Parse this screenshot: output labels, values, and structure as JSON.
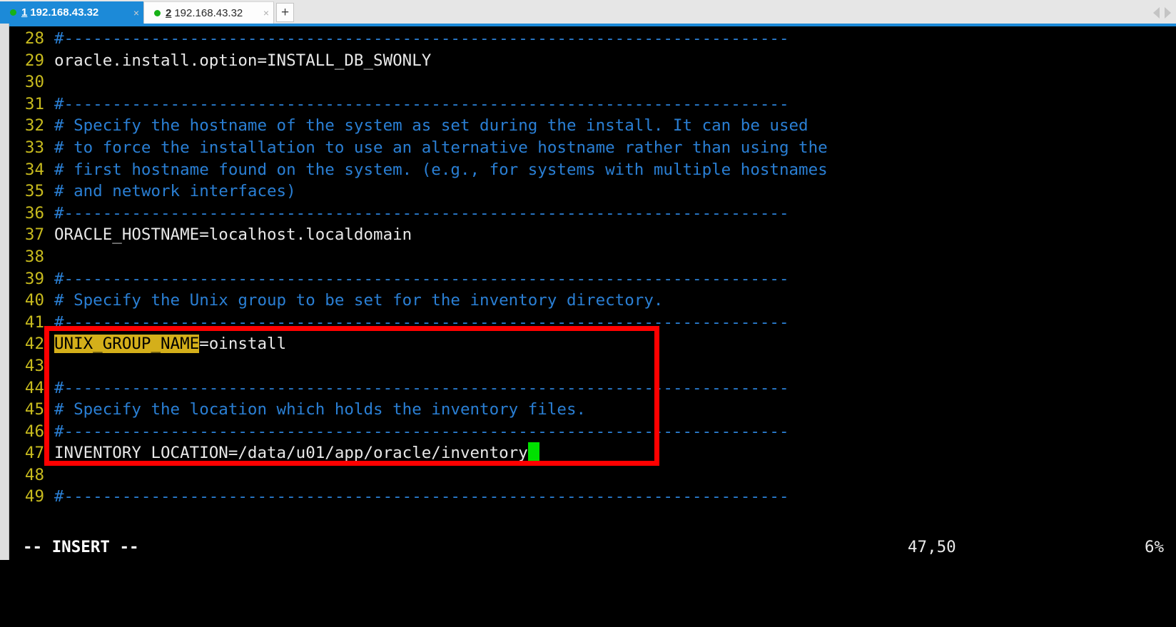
{
  "window": {
    "tabs": [
      {
        "number": "1",
        "host": "192.168.43.32",
        "close": "×",
        "active": true,
        "status_dot": "connected"
      },
      {
        "number": "2",
        "host": "192.168.43.32",
        "close": "×",
        "active": false,
        "status_dot": "connected"
      }
    ],
    "new_tab_label": "+",
    "scroll_left": "scroll-left-arrow",
    "scroll_right": "scroll-right-arrow"
  },
  "colors": {
    "active_tab_bg": "#1c8ad8",
    "tabbar_bg": "#e6e6e6",
    "terminal_bg": "#000000",
    "line_number": "#c8bb1e",
    "comment": "#2a7fd4",
    "code_text": "#e8e8e8",
    "search_highlight_bg": "#d4af1a",
    "search_highlight_fg": "#000000",
    "cursor": "#00e000",
    "annotation_box": "#ff0000"
  },
  "editor": {
    "lines": [
      {
        "num": "28",
        "segments": [
          {
            "t": "#---------------------------------------------------------------------------",
            "c": "comment"
          }
        ]
      },
      {
        "num": "29",
        "segments": [
          {
            "t": "oracle.install.option=INSTALL_DB_SWONLY",
            "c": "text"
          }
        ]
      },
      {
        "num": "30",
        "segments": []
      },
      {
        "num": "31",
        "segments": [
          {
            "t": "#---------------------------------------------------------------------------",
            "c": "comment"
          }
        ]
      },
      {
        "num": "32",
        "segments": [
          {
            "t": "# Specify the hostname of the system as set during the install. It can be used",
            "c": "comment"
          }
        ]
      },
      {
        "num": "33",
        "segments": [
          {
            "t": "# to force the installation to use an alternative hostname rather than using the",
            "c": "comment"
          }
        ]
      },
      {
        "num": "34",
        "segments": [
          {
            "t": "# first hostname found on the system. (e.g., for systems with multiple hostnames",
            "c": "comment"
          }
        ]
      },
      {
        "num": "35",
        "segments": [
          {
            "t": "# and network interfaces)",
            "c": "comment"
          }
        ]
      },
      {
        "num": "36",
        "segments": [
          {
            "t": "#---------------------------------------------------------------------------",
            "c": "comment"
          }
        ]
      },
      {
        "num": "37",
        "segments": [
          {
            "t": "ORACLE_HOSTNAME=localhost.localdomain",
            "c": "text"
          }
        ]
      },
      {
        "num": "38",
        "segments": []
      },
      {
        "num": "39",
        "segments": [
          {
            "t": "#---------------------------------------------------------------------------",
            "c": "comment"
          }
        ]
      },
      {
        "num": "40",
        "segments": [
          {
            "t": "# Specify the Unix group to be set for the inventory directory.",
            "c": "comment"
          }
        ]
      },
      {
        "num": "41",
        "segments": [
          {
            "t": "#---------------------------------------------------------------------------",
            "c": "comment"
          }
        ]
      },
      {
        "num": "42",
        "segments": [
          {
            "t": "UNIX_GROUP_NAME",
            "c": "hl"
          },
          {
            "t": "=oinstall",
            "c": "text"
          }
        ]
      },
      {
        "num": "43",
        "segments": []
      },
      {
        "num": "44",
        "segments": [
          {
            "t": "#---------------------------------------------------------------------------",
            "c": "comment"
          }
        ]
      },
      {
        "num": "45",
        "segments": [
          {
            "t": "# Specify the location which holds the inventory files.",
            "c": "comment"
          }
        ]
      },
      {
        "num": "46",
        "segments": [
          {
            "t": "#---------------------------------------------------------------------------",
            "c": "comment"
          }
        ]
      },
      {
        "num": "47",
        "segments": [
          {
            "t": "INVENTORY_LOCATION=/data/u01/app/oracle/inventory",
            "c": "text"
          },
          {
            "t": " ",
            "c": "cursor"
          }
        ]
      },
      {
        "num": "48",
        "segments": []
      },
      {
        "num": "49",
        "segments": [
          {
            "t": "#---------------------------------------------------------------------------",
            "c": "comment"
          }
        ]
      }
    ]
  },
  "status": {
    "mode": "-- INSERT --",
    "position": "47,50",
    "percent": "6%"
  },
  "annotation": {
    "type": "red-rectangle",
    "covers_lines": "42-47"
  }
}
